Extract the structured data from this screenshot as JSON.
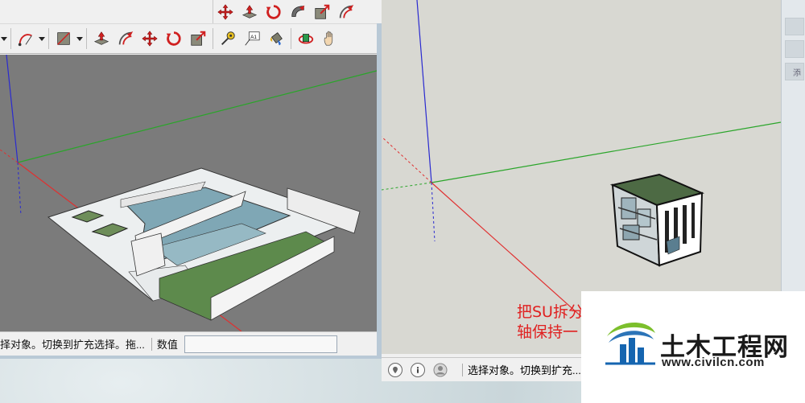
{
  "left_window": {
    "status_text": "择对象。切换到扩充选择。拖...",
    "measurements_label": "数值",
    "measurements_value": ""
  },
  "right_window": {
    "status_text": "选择对象。切换到扩充...",
    "annotation_line1": "把SU拆分",
    "annotation_line2": "轴保持一"
  },
  "watermark": {
    "name": "土木工程网",
    "url": "www.civilcn.com"
  },
  "right_edge": {
    "item_label": "添"
  },
  "colors": {
    "axis_red": "#e03030",
    "axis_green": "#2aa52a",
    "axis_blue": "#2a2ad0",
    "water": "#7fa7b5",
    "grass": "#5d8a4c",
    "annotation_red": "#e02020",
    "logo_blue": "#1565b0",
    "logo_green": "#7cbf2c"
  },
  "icons": {
    "top_toolbar": [
      "move-icon",
      "push-pull-icon",
      "rotate-icon",
      "follow-me-icon",
      "scale-icon",
      "offset-icon"
    ],
    "main_toolbar": [
      "arc-icon",
      "rectangle-icon",
      "push-pull-icon",
      "offset-icon",
      "move-icon",
      "rotate-icon",
      "scale-icon",
      "tape-measure-icon",
      "text-icon",
      "paint-bucket-icon",
      "orbit-icon",
      "pan-icon"
    ],
    "status_right": [
      "geolocation-icon",
      "info-icon",
      "user-icon"
    ]
  }
}
